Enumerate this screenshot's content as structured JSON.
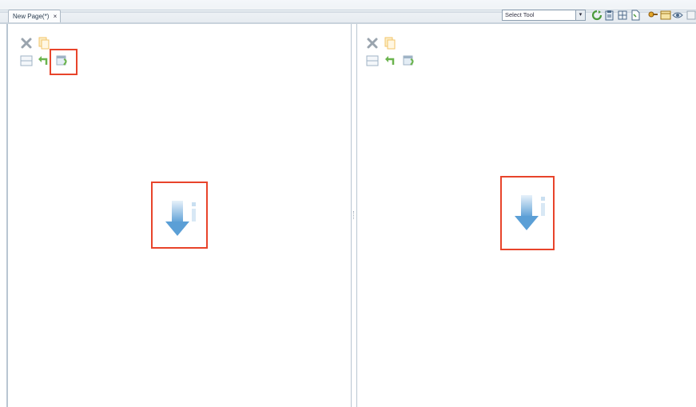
{
  "editor_tab": {
    "label": "New Page(*)",
    "close_glyph": "×"
  },
  "toolbar": {
    "select_value": "Select Tool",
    "icons": [
      "refresh-icon",
      "clipboard-icon",
      "grid-icon",
      "page-icon",
      "key-icon",
      "table-icon",
      "preview-icon",
      "more-icon"
    ]
  },
  "panes": {
    "left": {
      "controls": [
        "remove-icon",
        "paste-icon",
        "split-icon",
        "undo-icon",
        "restore-layout-icon"
      ],
      "drop_target_highlighted": true,
      "restore_highlighted": true
    },
    "right": {
      "controls": [
        "remove-icon",
        "paste-icon",
        "split-icon",
        "undo-icon",
        "restore-layout-icon"
      ],
      "drop_target_highlighted": true,
      "restore_highlighted": false
    }
  },
  "colors": {
    "highlight": "#e8442b",
    "accent_blue": "#6aa9dc",
    "disabled_orange": "#f3c46a",
    "green": "#6bb44e"
  }
}
